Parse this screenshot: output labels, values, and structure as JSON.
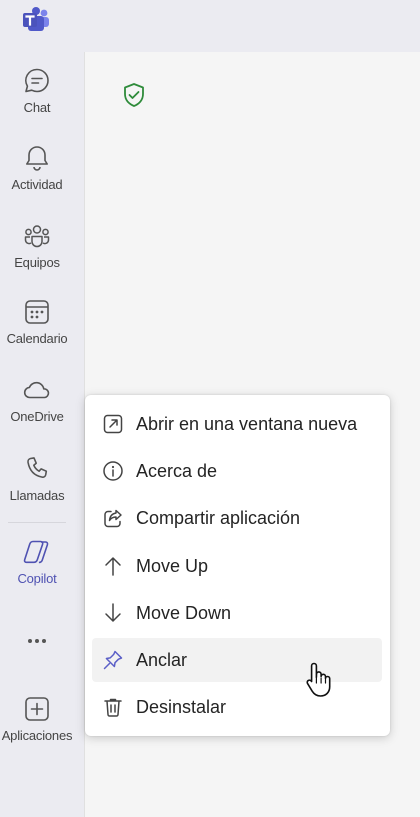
{
  "rail": {
    "items": [
      {
        "label": "Chat"
      },
      {
        "label": "Actividad"
      },
      {
        "label": "Equipos"
      },
      {
        "label": "Calendario"
      },
      {
        "label": "OneDrive"
      },
      {
        "label": "Llamadas"
      },
      {
        "label": "Copilot"
      },
      {
        "label": "Aplicaciones"
      }
    ]
  },
  "context_menu": {
    "items": [
      {
        "label": "Abrir en una ventana nueva",
        "icon": "open-external-icon"
      },
      {
        "label": "Acerca de",
        "icon": "info-icon"
      },
      {
        "label": "Compartir aplicación",
        "icon": "share-icon"
      },
      {
        "label": "Move Up",
        "icon": "arrow-up-icon"
      },
      {
        "label": "Move Down",
        "icon": "arrow-down-icon"
      },
      {
        "label": "Anclar",
        "icon": "pin-icon"
      },
      {
        "label": "Desinstalar",
        "icon": "trash-icon"
      }
    ],
    "hovered_item": "Anclar"
  },
  "colors": {
    "accent": "#4f52b2",
    "shield": "#2e8b3a"
  }
}
